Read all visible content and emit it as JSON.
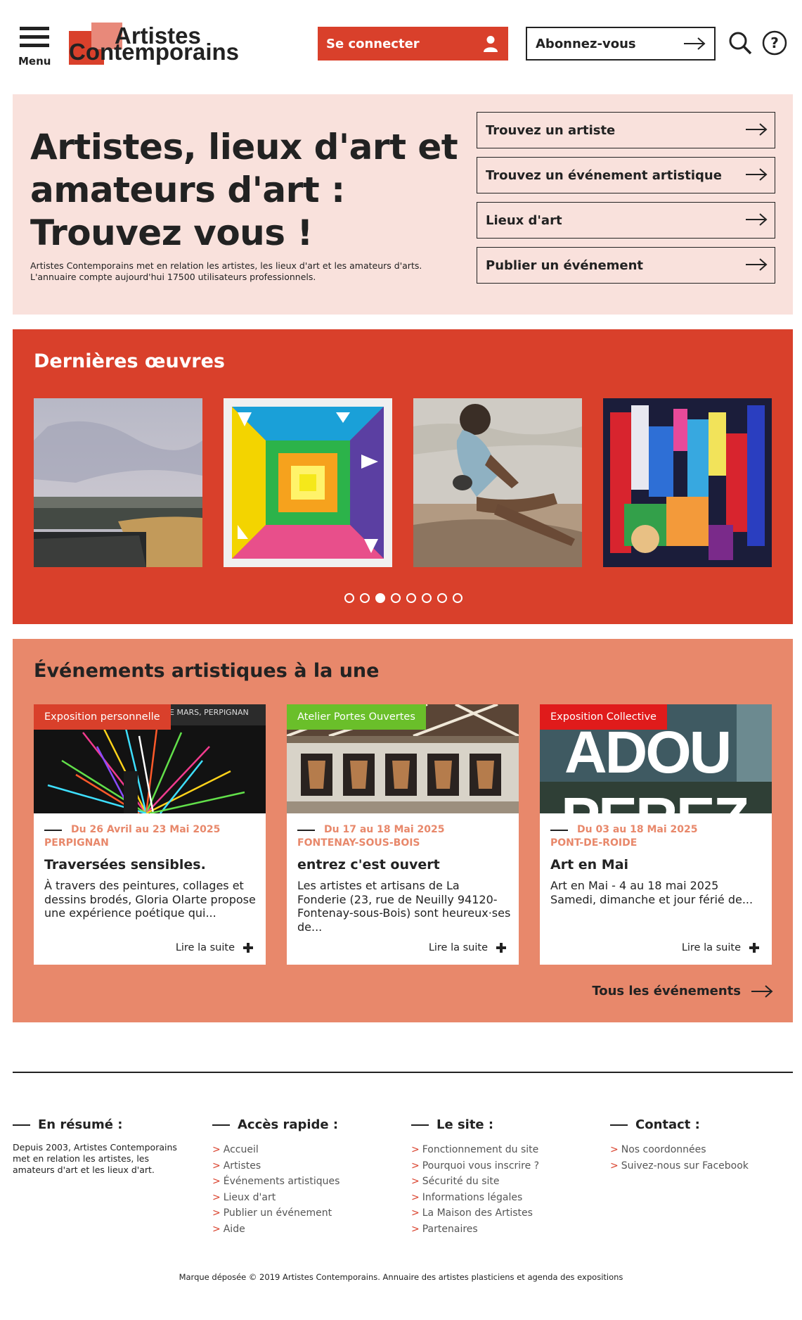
{
  "header": {
    "menu_label": "Menu",
    "logo_line1": "Artistes",
    "logo_line2": "Contemporains",
    "connect_label": "Se connecter",
    "subscribe_label": "Abonnez-vous",
    "icons": [
      "menu-icon",
      "user-icon",
      "arrow-right-icon",
      "search-icon",
      "help-icon"
    ]
  },
  "hero": {
    "heading": "Artistes, lieux d'art et amateurs d'art : Trouvez vous !",
    "intro_line1": "Artistes Contemporains met en relation les artistes, les lieux d'art et les amateurs d'arts.",
    "intro_line2": "L'annuaire compte aujourd'hui 17500 utilisateurs professionnels.",
    "links": [
      {
        "label": "Trouvez un artiste"
      },
      {
        "label": "Trouvez un événement artistique"
      },
      {
        "label": "Lieux d'art"
      },
      {
        "label": "Publier un événement"
      }
    ]
  },
  "works": {
    "title": "Dernières œuvres",
    "slides": 8,
    "active_slide": 3
  },
  "events": {
    "title": "Événements artistiques à la une",
    "all_label": "Tous les événements",
    "cards": [
      {
        "tag": "Exposition personnelle",
        "tag_color": "#d9402b",
        "img_caption": "E MARS, PERPIGNAN",
        "date": "Du 26 Avril au 23 Mai 2025",
        "city": "PERPIGNAN",
        "title": "Traversées sensibles.",
        "excerpt": "À travers des peintures, collages et dessins brodés, Gloria Olarte propose une expérience poétique qui...",
        "more": "Lire la suite"
      },
      {
        "tag": "Atelier Portes Ouvertes",
        "tag_color": "#6abf2a",
        "date": "Du 17 au 18 Mai 2025",
        "city": "FONTENAY-SOUS-BOIS",
        "title": "entrez c'est ouvert",
        "excerpt": "Les artistes et artisans de La Fonderie (23, rue de Neuilly 94120-Fontenay-sous-Bois) sont heureux·ses de...",
        "more": "Lire la suite"
      },
      {
        "tag": "Exposition Collective",
        "tag_color": "#e01b1b",
        "img_text1": "ADOU",
        "img_text2": "PEREZ",
        "date": "Du 03 au 18 Mai 2025",
        "city": "PONT-DE-ROIDE",
        "title": "Art en Mai",
        "excerpt": "Art en Mai - 4 au 18 mai 2025 Samedi, dimanche et jour férié de...",
        "more": "Lire la suite"
      }
    ]
  },
  "footer": {
    "col1": {
      "title": "En résumé :",
      "text": "Depuis 2003, Artistes Contemporains met en relation les artistes, les amateurs d'art et les lieux d'art."
    },
    "col2": {
      "title": "Accès rapide :",
      "links": [
        "Accueil",
        "Artistes",
        "Événements artistiques",
        "Lieux d'art",
        "Publier un événement",
        "Aide"
      ]
    },
    "col3": {
      "title": "Le site :",
      "links": [
        "Fonctionnement du site",
        "Pourquoi vous inscrire ?",
        "Sécurité du site",
        "Informations légales",
        "La Maison des Artistes",
        "Partenaires"
      ]
    },
    "col4": {
      "title": "Contact :",
      "links": [
        "Nos coordonnées",
        "Suivez-nous sur Facebook"
      ]
    },
    "copyright": "Marque déposée © 2019 Artistes Contemporains. Annuaire des artistes plasticiens et agenda des expositions"
  },
  "colors": {
    "brand_red": "#d9402b",
    "salmon": "#e8886b",
    "pale_pink": "#f9e1dc"
  }
}
